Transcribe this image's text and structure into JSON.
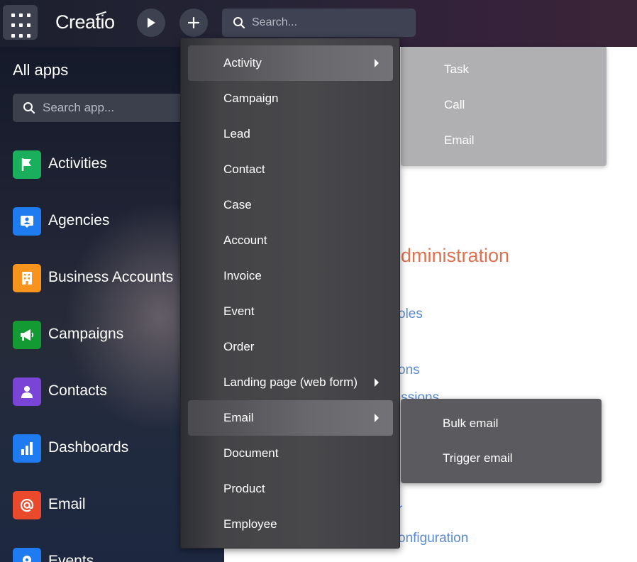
{
  "topbar": {
    "logo_text": "Creatio",
    "search_placeholder": "Search..."
  },
  "sidebar": {
    "title": "All apps",
    "search_placeholder": "Search app...",
    "apps": [
      {
        "label": "Activities",
        "icon": "flag-icon",
        "color": "#1aaf5d"
      },
      {
        "label": "Agencies",
        "icon": "person-card-icon",
        "color": "#1f7cf0"
      },
      {
        "label": "Business Accounts",
        "icon": "building-icon",
        "color": "#f7941d"
      },
      {
        "label": "Campaigns",
        "icon": "megaphone-icon",
        "color": "#149a33"
      },
      {
        "label": "Contacts",
        "icon": "person-icon",
        "color": "#7a44d6"
      },
      {
        "label": "Dashboards",
        "icon": "bar-chart-icon",
        "color": "#1f7cf0"
      },
      {
        "label": "Email",
        "icon": "at-sign-icon",
        "color": "#e94a2c"
      },
      {
        "label": "Events",
        "icon": "location-pin-icon",
        "color": "#1f7cf0"
      }
    ]
  },
  "menu": {
    "items": [
      {
        "label": "Activity",
        "has_submenu": true,
        "highlighted": true
      },
      {
        "label": "Campaign"
      },
      {
        "label": "Lead"
      },
      {
        "label": "Contact"
      },
      {
        "label": "Case"
      },
      {
        "label": "Account"
      },
      {
        "label": "Invoice"
      },
      {
        "label": "Event"
      },
      {
        "label": "Order"
      },
      {
        "label": "Landing page (web form)",
        "has_submenu": true
      },
      {
        "label": "Email",
        "has_submenu": true,
        "highlighted": true
      },
      {
        "label": "Document"
      },
      {
        "label": "Product"
      },
      {
        "label": "Employee"
      }
    ]
  },
  "activity_submenu": [
    "Task",
    "Call",
    "Email"
  ],
  "email_submenu": [
    "Bulk email",
    "Trigger email"
  ],
  "content": {
    "title": "dministration",
    "links": [
      "oles",
      "ons",
      "issions",
      "r",
      "onfiguration"
    ]
  },
  "colors": {
    "accent_orange": "#e1704f",
    "link_blue": "#5b8ad6"
  }
}
